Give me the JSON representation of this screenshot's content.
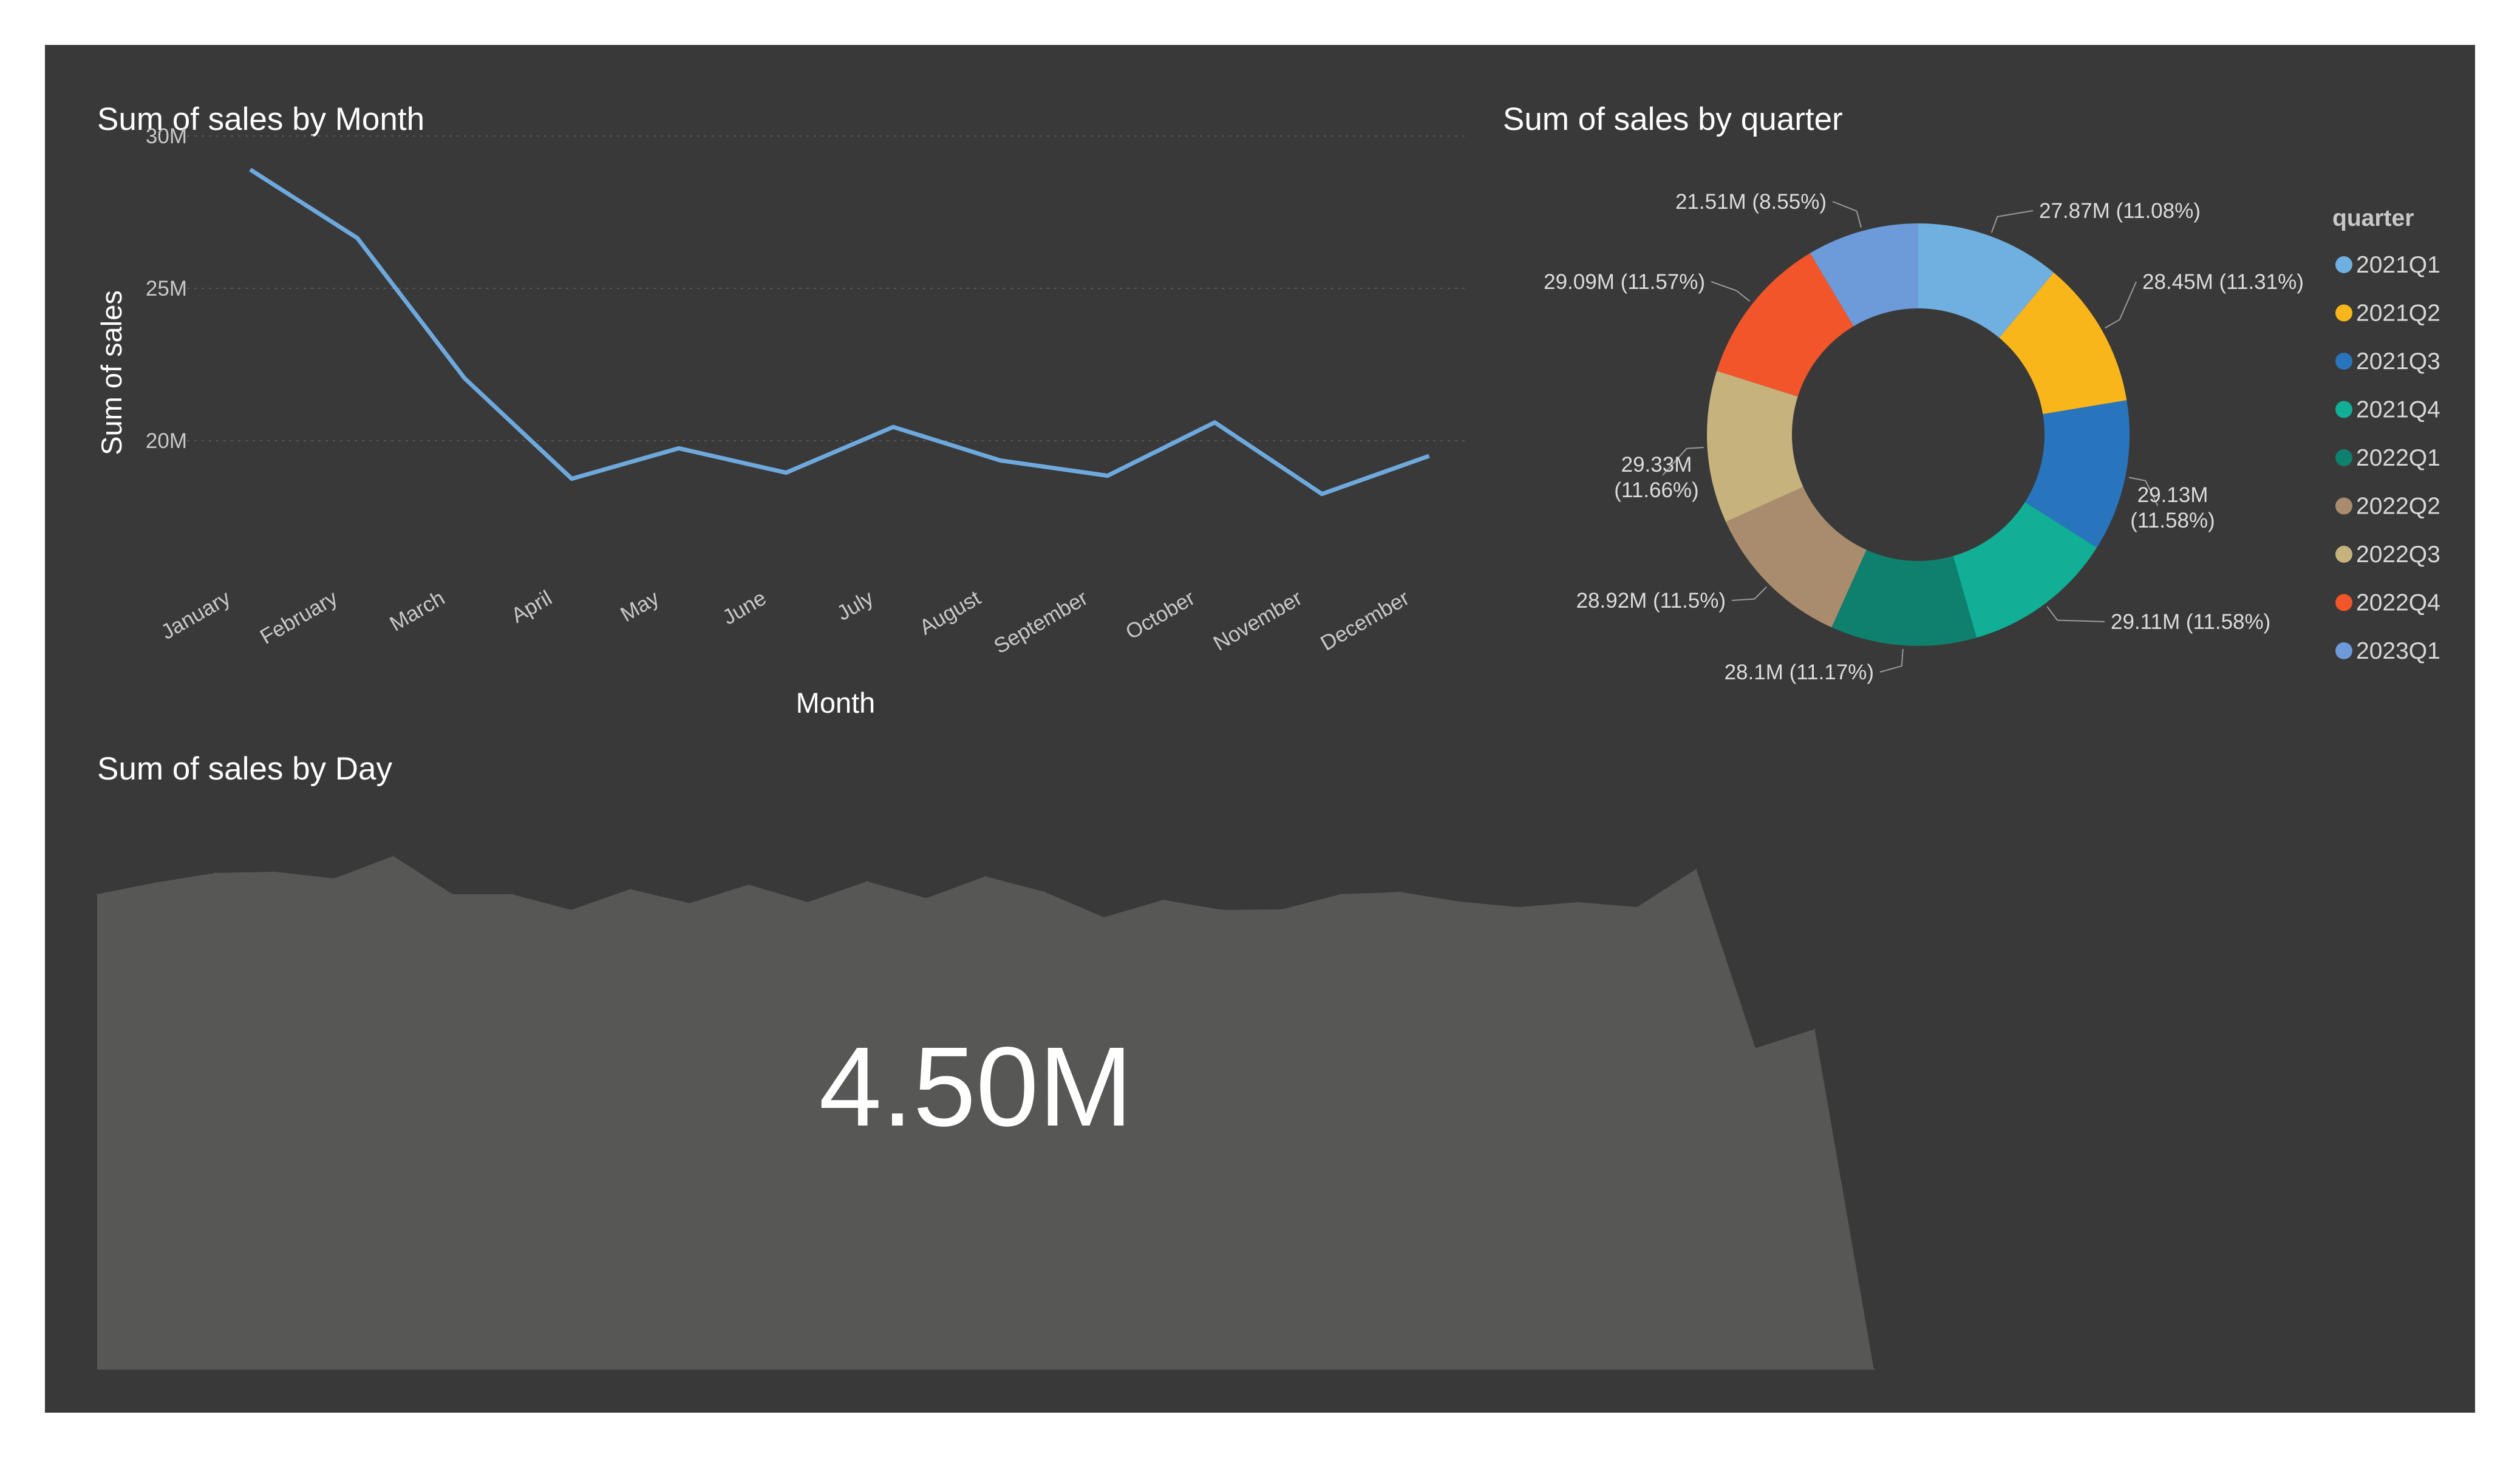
{
  "colors": {
    "background": "#393939",
    "line": "#6ea9de",
    "area": "#575755",
    "grid": "#575757"
  },
  "chart_data": [
    {
      "type": "line",
      "title": "Sum of sales by Month",
      "xlabel": "Month",
      "ylabel": "Sum of sales",
      "categories": [
        "January",
        "February",
        "March",
        "April",
        "May",
        "June",
        "July",
        "August",
        "September",
        "October",
        "November",
        "December"
      ],
      "values": [
        28.9,
        26.65,
        22.05,
        18.75,
        19.75,
        18.95,
        20.45,
        19.35,
        18.85,
        20.6,
        18.25,
        19.5
      ],
      "yticks": [
        {
          "value": 20,
          "label": "20M"
        },
        {
          "value": 25,
          "label": "25M"
        },
        {
          "value": 30,
          "label": "30M"
        }
      ],
      "ylim": [
        16.65,
        30.6
      ],
      "grid": true
    },
    {
      "type": "pie",
      "title": "Sum of sales by quarter",
      "legend_title": "quarter",
      "legend_position": "right",
      "slices": [
        {
          "label": "2021Q1",
          "value": 27.87,
          "text": "27.87M (11.08%)",
          "color": "#6fb0e1"
        },
        {
          "label": "2021Q2",
          "value": 28.45,
          "text": "28.45M (11.31%)",
          "color": "#f8b61b"
        },
        {
          "label": "2021Q3",
          "value": 29.13,
          "text": [
            "29.13M",
            "(11.58%)"
          ],
          "color": "#2975bd"
        },
        {
          "label": "2021Q4",
          "value": 29.11,
          "text": "29.11M (11.58%)",
          "color": "#10af96"
        },
        {
          "label": "2022Q1",
          "value": 28.1,
          "text": "28.1M (11.17%)",
          "color": "#0e806d"
        },
        {
          "label": "2022Q2",
          "value": 28.92,
          "text": "28.92M (11.5%)",
          "color": "#a98c6e"
        },
        {
          "label": "2022Q3",
          "value": 29.33,
          "text": [
            "29.33M",
            "(11.66%)"
          ],
          "color": "#c6b27d"
        },
        {
          "label": "2022Q4",
          "value": 29.09,
          "text": "29.09M (11.57%)",
          "color": "#f2552a"
        },
        {
          "label": "2023Q1",
          "value": 21.51,
          "text": "21.51M (8.55%)",
          "color": "#6d9ad8"
        }
      ]
    },
    {
      "type": "area",
      "title": "Sum of sales by Day",
      "x": [
        1,
        2,
        3,
        4,
        5,
        6,
        7,
        8,
        9,
        10,
        11,
        12,
        13,
        14,
        15,
        16,
        17,
        18,
        19,
        20,
        21,
        22,
        23,
        24,
        25,
        26,
        27,
        28,
        29,
        30,
        31
      ],
      "values": [
        8.46,
        8.67,
        8.84,
        8.86,
        8.74,
        9.14,
        8.46,
        8.46,
        8.18,
        8.55,
        8.3,
        8.63,
        8.32,
        8.69,
        8.39,
        8.78,
        8.5,
        8.05,
        8.36,
        8.18,
        8.19,
        8.46,
        8.5,
        8.33,
        8.23,
        8.32,
        8.23,
        8.91,
        5.72,
        6.06,
        0.0
      ],
      "ylim": [
        0,
        10.2
      ]
    }
  ],
  "kpi": {
    "value": "4.50M"
  }
}
